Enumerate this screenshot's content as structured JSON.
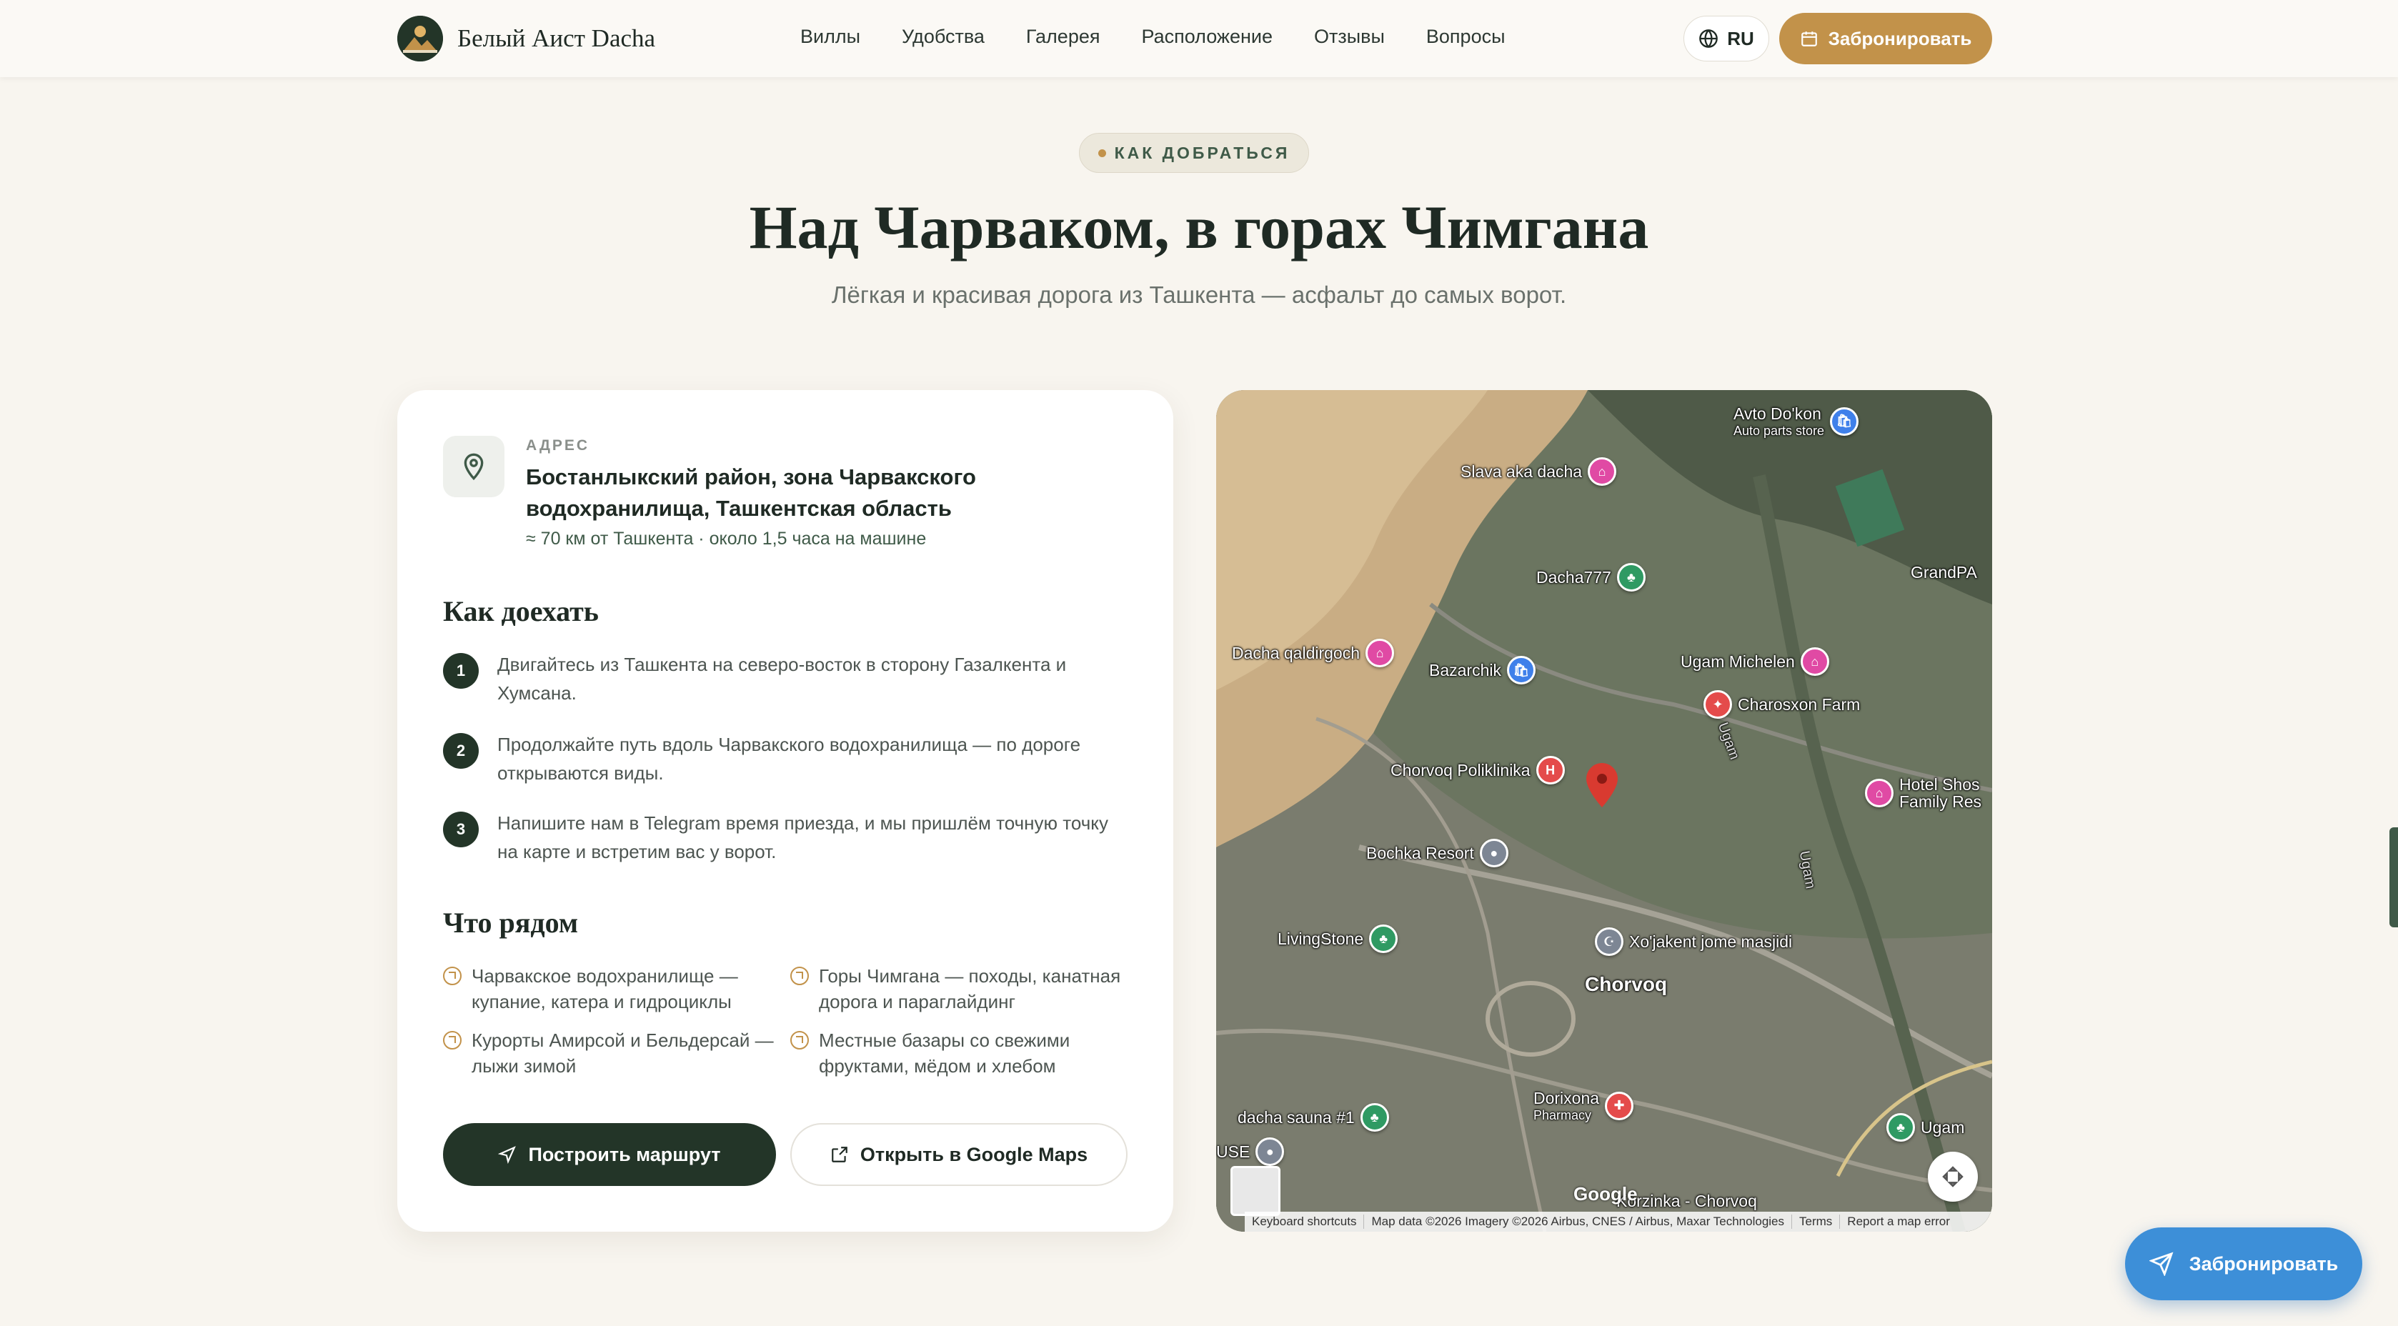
{
  "nav": {
    "brand": "Белый Аист Dacha",
    "links": [
      "Виллы",
      "Удобства",
      "Галерея",
      "Расположение",
      "Отзывы",
      "Вопросы"
    ],
    "lang": "RU",
    "book": "Забронировать"
  },
  "section": {
    "eyebrow": "КАК ДОБРАТЬСЯ",
    "title": "Над Чарваком, в горах Чимгана",
    "subtitle": "Лёгкая и красивая дорога из Ташкента — асфальт до самых ворот."
  },
  "address": {
    "label": "АДРЕС",
    "text": "Бостанлыкский район, зона Чарвакского водохранилища, Ташкентская область",
    "note": "≈ 70 км от Ташкента · около 1,5 часа на машине"
  },
  "how": {
    "title": "Как доехать",
    "steps": [
      {
        "num": "1",
        "text": "Двигайтесь из Ташкента на северо-восток в сторону Газалкента и Хумсана."
      },
      {
        "num": "2",
        "text": "Продолжайте путь вдоль Чарвакского водохранилища — по дороге открываются виды."
      },
      {
        "num": "3",
        "text": "Напишите нам в Telegram время приезда, и мы пришлём точную точку на карте и встретим вас у ворот."
      }
    ]
  },
  "nearby": {
    "title": "Что рядом",
    "items": [
      "Чарвакское водохранилище — купание, катера и гидроциклы",
      "Горы Чимгана — походы, канатная дорога и параглайдинг",
      "Курорты Амирсой и Бельдерсай — лыжи зимой",
      "Местные базары со свежими фруктами, мёдом и хлебом"
    ]
  },
  "buttons": {
    "route": "Построить маршрут",
    "maps": "Открыть в Google Maps"
  },
  "map": {
    "pois": [
      {
        "label": "Avto Do'kon",
        "sub": "Auto parts store",
        "color": "blue"
      },
      {
        "label": "Slava aka dacha",
        "color": "pink"
      },
      {
        "label": "Dacha777",
        "color": "green"
      },
      {
        "label": "GrandPA",
        "color": "pink"
      },
      {
        "label": "Dacha qaldirgoch",
        "color": "pink"
      },
      {
        "label": "Bazarchik",
        "color": "blue"
      },
      {
        "label": "Ugam Michelen",
        "color": "pink"
      },
      {
        "label": "Charosxon Farm",
        "color": "red"
      },
      {
        "label": "Chorvoq Poliklinika",
        "color": "red"
      },
      {
        "label": "Hotel Shos Family Res",
        "color": "pink"
      },
      {
        "label": "Bochka Resort",
        "color": "gray"
      },
      {
        "label": "LivingStone",
        "color": "green"
      },
      {
        "label": "Xo'jakent jome masjidi",
        "color": "gray"
      },
      {
        "label": "Chorvoq",
        "color": "none"
      },
      {
        "label": "Dorixona",
        "sub": "Pharmacy",
        "color": "red"
      },
      {
        "label": "dacha sauna #1",
        "color": "green"
      },
      {
        "label": "Ugam",
        "color": "green"
      },
      {
        "label": "USE",
        "color": "gray"
      },
      {
        "label": "Korzinka - Chorvoq",
        "color": "blue"
      }
    ],
    "road_labels": [
      "Ugam",
      "Ugam"
    ],
    "google": "Google",
    "attribution": [
      "Keyboard shortcuts",
      "Map data ©2026 Imagery ©2026 Airbus, CNES / Airbus, Maxar Technologies",
      "Terms",
      "Report a map error"
    ]
  },
  "floating": {
    "book": "Забронировать"
  },
  "colors": {
    "primary_dark": "#233528",
    "accent_gold": "#c2924a",
    "float_blue": "#3d8fd8",
    "background": "#f8f5ef"
  }
}
